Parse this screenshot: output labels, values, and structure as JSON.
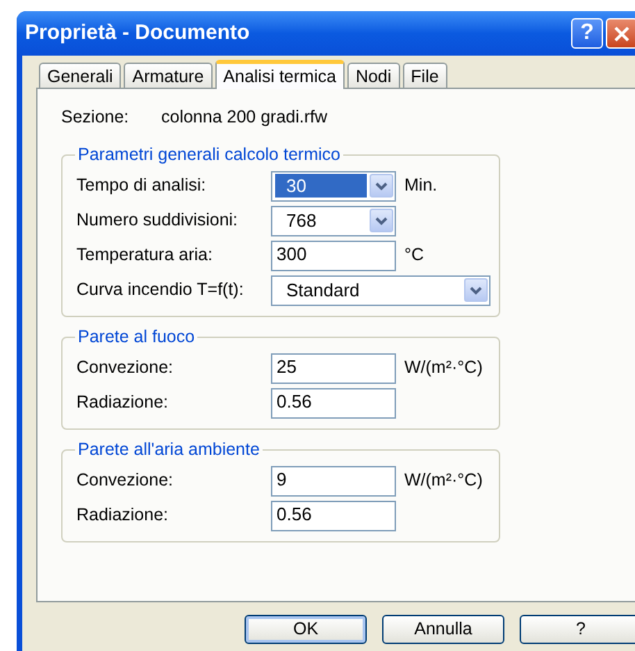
{
  "window": {
    "title": "Proprietà - Documento"
  },
  "title_buttons": [
    {
      "kind": "help",
      "label": "?"
    },
    {
      "kind": "close"
    }
  ],
  "tabs": [
    {
      "label": "Generali",
      "selected": false
    },
    {
      "label": "Armature",
      "selected": false
    },
    {
      "label": "Analisi termica",
      "selected": true
    },
    {
      "label": "Nodi",
      "selected": false
    },
    {
      "label": "File",
      "selected": false
    }
  ],
  "section": {
    "label": "Sezione:",
    "value": "colonna 200 gradi.rfw"
  },
  "groups": [
    {
      "title": "Parametri generali calcolo termico",
      "rows": [
        {
          "kind": "combo",
          "label": "Tempo di analisi:",
          "value": "30",
          "unit": "Min.",
          "selected": true,
          "wide": false
        },
        {
          "kind": "combo",
          "label": "Numero suddivisioni:",
          "value": "768",
          "selected": false,
          "wide": false
        },
        {
          "kind": "text",
          "label": "Temperatura aria:",
          "value": "300",
          "unit": "°C"
        },
        {
          "kind": "combo",
          "label": "Curva incendio T=f(t):",
          "value": "Standard",
          "selected": false,
          "wide": true
        }
      ]
    },
    {
      "title": "Parete al fuoco",
      "rows": [
        {
          "kind": "text",
          "label": "Convezione:",
          "value": "25",
          "unit": "W/(m²·°C)"
        },
        {
          "kind": "text",
          "label": "Radiazione:",
          "value": "0.56"
        }
      ]
    },
    {
      "title": "Parete all'aria ambiente",
      "rows": [
        {
          "kind": "text",
          "label": "Convezione:",
          "value": "9",
          "unit": "W/(m²·°C)"
        },
        {
          "kind": "text",
          "label": "Radiazione:",
          "value": "0.56"
        }
      ]
    }
  ],
  "buttons": [
    {
      "label": "OK",
      "default": true
    },
    {
      "label": "Annulla",
      "default": false
    },
    {
      "label": "?",
      "default": false
    }
  ]
}
